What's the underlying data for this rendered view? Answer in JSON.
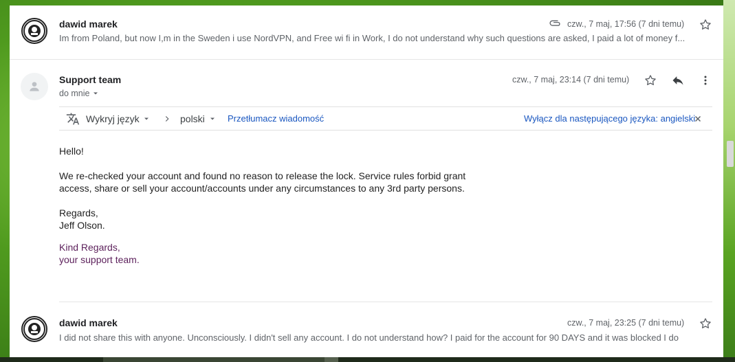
{
  "messages": [
    {
      "sender": "dawid marek",
      "date": "czw., 7 maj, 17:56 (7 dni temu)",
      "snippet": "Im from Poland, but now I,m in the Sweden i use NordVPN, and Free wi fi in Work, I do not understand why such questions are asked, I paid a lot of money f..."
    },
    {
      "sender": "Support team",
      "recipient": "do mnie",
      "date": "czw., 7 maj, 23:14 (7 dni temu)",
      "translate": {
        "detect_label": "Wykryj język",
        "target_label": "polski",
        "translate_link": "Przetłumacz wiadomość",
        "disable_link": "Wyłącz dla następującego języka: angielski"
      },
      "body": {
        "greeting": "Hello!",
        "para_line1": "We re-checked your account and found no reason to release the lock. Service rules forbid grant",
        "para_line2": "access, share or sell your account/accounts under any circumstances to any 3rd party persons.",
        "regards": "Regards,",
        "name": "Jeff Olson.",
        "sig_line1": "Kind Regards,",
        "sig_line2": "your support team."
      }
    },
    {
      "sender": "dawid marek",
      "date": "czw., 7 maj, 23:25 (7 dni temu)",
      "snippet": "I did not share this with anyone. Unconsciously. I didn't sell any account. I do not understand how? I paid for the account for 90 DAYS and it was blocked I do"
    }
  ],
  "icons": {
    "attachment": "paperclip-icon",
    "star": "star-icon",
    "reply": "reply-icon",
    "more": "more-vert-icon",
    "translate": "translate-icon",
    "close": "close-icon"
  },
  "colors": {
    "link": "#1a57c0",
    "signature": "#5b1f5a",
    "muted": "#5f6368"
  }
}
